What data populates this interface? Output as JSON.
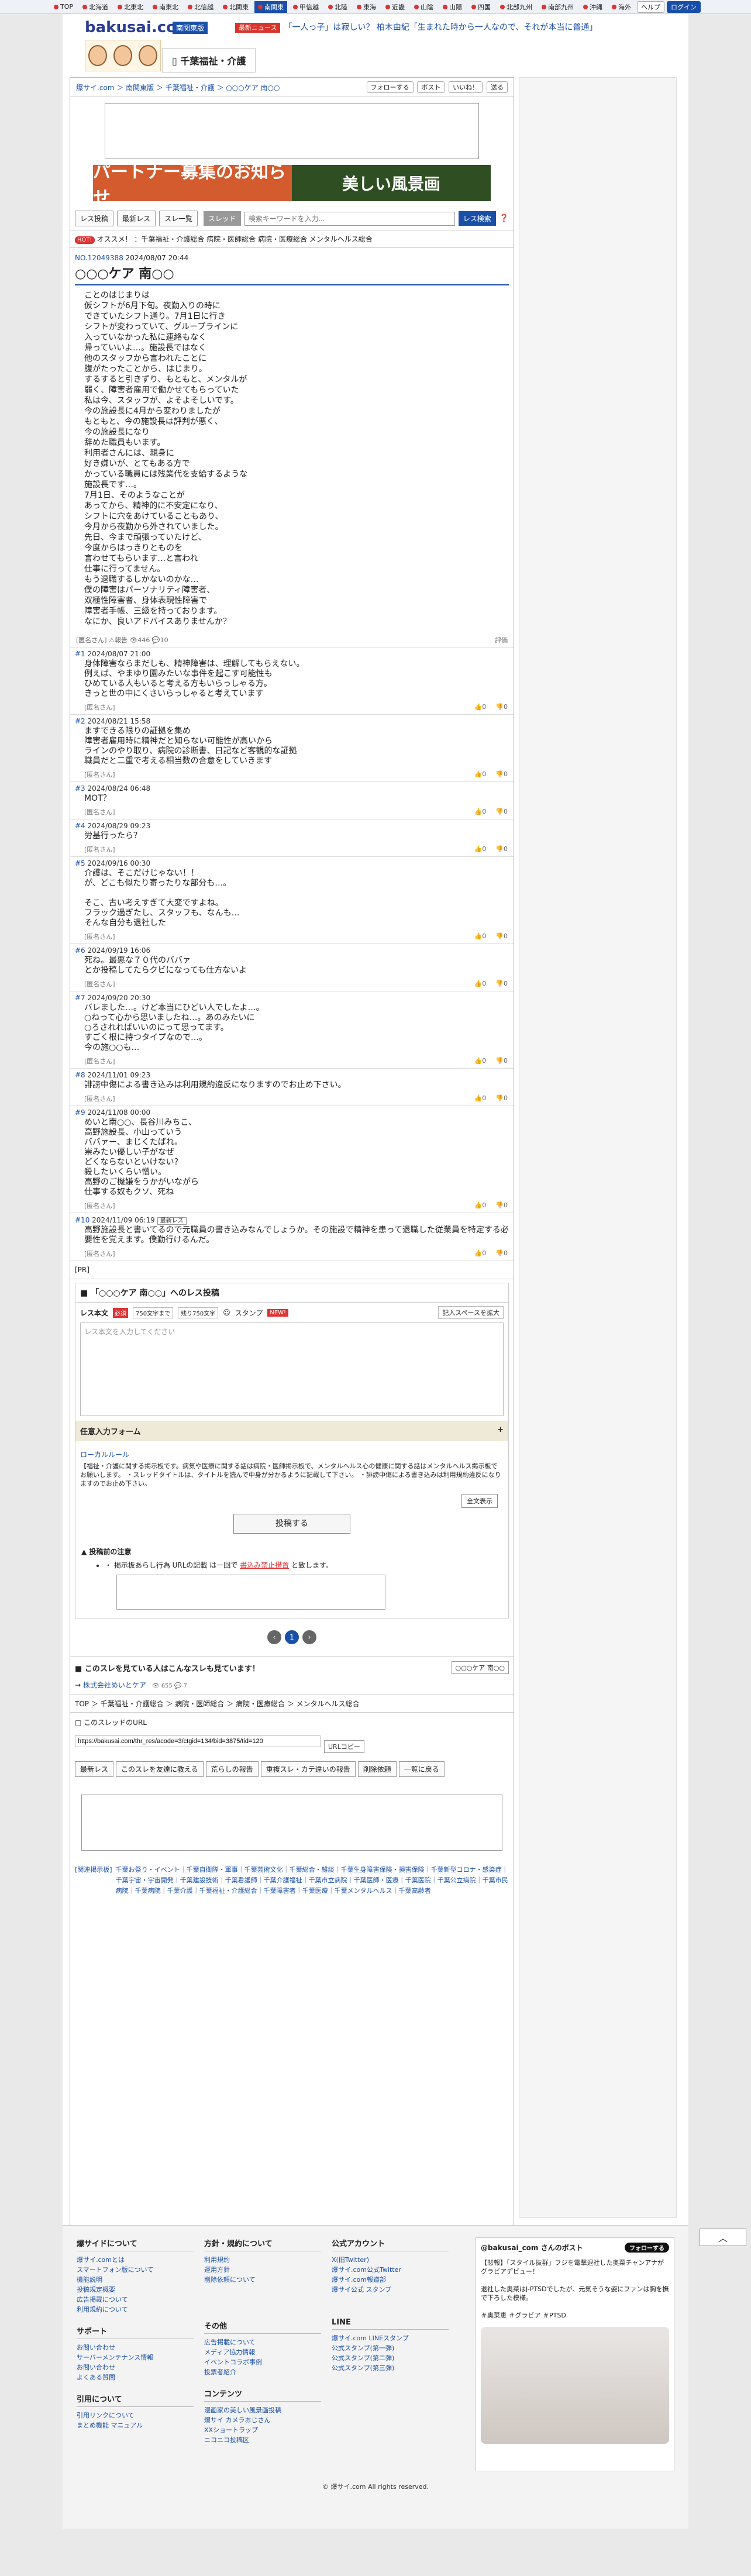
{
  "regionbar": {
    "items": [
      {
        "label": "TOP"
      },
      {
        "label": "北海道"
      },
      {
        "label": "北東北"
      },
      {
        "label": "南東北"
      },
      {
        "label": "北信越"
      },
      {
        "label": "北関東"
      },
      {
        "label": "南関東",
        "active": true
      },
      {
        "label": "甲信越"
      },
      {
        "label": "北陸"
      },
      {
        "label": "東海"
      },
      {
        "label": "近畿"
      },
      {
        "label": "山陰"
      },
      {
        "label": "山陽"
      },
      {
        "label": "四国"
      },
      {
        "label": "北部九州"
      },
      {
        "label": "南部九州"
      },
      {
        "label": "沖縄"
      },
      {
        "label": "海外"
      }
    ],
    "help": "ヘルプ",
    "login": "ログイン"
  },
  "header": {
    "logo": "bakusai.com",
    "logo_suffix": "",
    "region": "南関東版",
    "news_tag": "最新ニュース",
    "news": "「一人っ子」は寂しい？ 柏木由紀「生まれた時から一人なので、それが本当に普通」",
    "category": "千葉福祉・介護"
  },
  "breadcrumb": {
    "text": "爆サイ.com ＞ 南関東版 ＞ 千葉福祉・介護 ＞ ○○○ケア 南○○",
    "follow": "フォローする",
    "post": "ポスト",
    "like": "いいね！",
    "send": "送る"
  },
  "banner": {
    "left": "パートナー募集のお知らせ",
    "right": "美しい風景画"
  },
  "toolbar": {
    "b1": "レス投稿",
    "b2": "最新レス",
    "b3": "スレ一覧",
    "select": "スレッド",
    "placeholder": "検索キーワードを入力...",
    "search": "レス検索"
  },
  "tags": {
    "hot": "HOT!",
    "text": "オススメ！ ：千葉福祉・介護総合 病院・医師総合 病院・医療総合 メンタルヘルス総合"
  },
  "thread": {
    "number": "NO.12049388",
    "date": "2024/08/07 20:44",
    "title": "○○○ケア 南○○",
    "body": "ことのはじまりは\n仮シフトが6月下旬。夜勤入りの時に\nできていたシフト通り。7月1日に行き\nシフトが変わっていて、グループラインに\n入っていなかった私に連絡もなく\n帰っていいよ…。施設長ではなく\n他のスタッフから言われたことに\n腹がたったことから、はじまり。\nするすると引きずり、もともと、メンタルが\n弱く、障害者雇用で働かせてもらっていた\n私は今、スタッフが、よそよそしいです。\n今の施設長に4月から変わりましたが\nもともと、今の施設長は評判が悪く、\n今の施設長になり\n辞めた職員もいます。\n利用者さんには、親身に\n好き嫌いが、とてもある方で\nかっている職員には残業代を支給するような\n施設長です…。\n7月1日、そのようなことが\nあってから、精神的に不安定になり、\nシフトに穴をあけていることもあり、\n今月から夜勤から外されていました。\n先日、今まで頑張っていたけど、\n今度からはっきりとものを\n言わせてもらいます…と言われ\n仕事に行ってません。\nもう退職するしかないのかな…\n僕の障害はパーソナリティ障害者、\n双極性障害者、身体表現性障害で\n障害者手帳、三級を持っております。\nなにか、良いアドバイスありませんか？",
    "author": "[匿名さん]",
    "report": "報告",
    "views": "446",
    "comments": "10",
    "label_eval": "評価"
  },
  "responses": [
    {
      "no": "#1",
      "date": "2024/08/07 21:00",
      "body": "身体障害ならまだしも、精神障害は、理解してもらえない。\n例えば、やまゆり園みたいな事件を起こす可能性も\nひめている人もいると考える方もいらっしゃる方。\nきっと世の中にくさいらっしゃると考えています",
      "author": "[匿名さん]",
      "up": "0",
      "down": "0"
    },
    {
      "no": "#2",
      "date": "2024/08/21 15:58",
      "body": "ますできる限りの証拠を集め\n障害者雇用時に精神だと知らない可能性が高いから\nラインのやり取り、病院の診断書、日記など客観的な証拠\n職員だと二重で考える相当数の合意をしていきます",
      "author": "[匿名さん]",
      "up": "0",
      "down": "0"
    },
    {
      "no": "#3",
      "date": "2024/08/24 06:48",
      "body": "MOT？",
      "author": "[匿名さん]",
      "up": "0",
      "down": "0"
    },
    {
      "no": "#4",
      "date": "2024/08/29 09:23",
      "body": "労基行ったら？",
      "author": "[匿名さん]",
      "up": "0",
      "down": "0"
    },
    {
      "no": "#5",
      "date": "2024/09/16 00:30",
      "body": "介護は、そこだけじゃない！！\nが、どこも似たり寄ったりな部分も…。\n\nそこ、古い考えすぎて大変ですよね。\nフラック過ぎたし、スタッフも、なんも…\nそんな自分も退社した",
      "author": "[匿名さん]",
      "up": "0",
      "down": "0"
    },
    {
      "no": "#6",
      "date": "2024/09/19 16:06",
      "body": "死ね。最悪な７０代のババァ\nとか投稿してたらクビになっても仕方ないよ",
      "author": "[匿名さん]",
      "up": "0",
      "down": "0"
    },
    {
      "no": "#7",
      "date": "2024/09/20 20:30",
      "body": "バレました…。けど本当にひどい人でしたよ…。\n○ねって心から思いましたね…。あのみたいに\n○ろされればいいのにって思ってます。\nすごく根に持つタイプなので…。\n今の施○○も…",
      "author": "[匿名さん]",
      "up": "0",
      "down": "0"
    },
    {
      "no": "#8",
      "date": "2024/11/01 09:23",
      "body": "誹謗中傷による書き込みは利用規約違反になりますのでお止め下さい。",
      "author": "[匿名さん]",
      "up": "0",
      "down": "0"
    },
    {
      "no": "#9",
      "date": "2024/11/08 00:00",
      "body": "めいと南○○、長谷川みちこ、\n高野施設長、小山っていう\nババァー、まじくたばれ。\n崇みたい優しい子がなぜ\nどくならないといけない？\n殺したいくらい憎い。\n高野のご機嫌をうかがいながら\n仕事する奴もクソ、死ね\n",
      "author": "[匿名さん]",
      "up": "0",
      "down": "0"
    },
    {
      "no": "#10",
      "date": "2024/11/09 06:19",
      "newest": "最新レス",
      "body": "高野施設長と書いてるので元職員の書き込みなんでしょうか。その施設で精神を患って退職した従業員を特定する必要性を覚えます。僕勤行けるんだ。",
      "author": "[匿名さん]",
      "up": "0",
      "down": "0"
    }
  ],
  "pr": "[PR]",
  "form": {
    "title": "「○○○ケア 南○○」へのレス投稿",
    "name": "レス本文",
    "req": "必須",
    "chip1": "750文字まで",
    "chip2": "残り750文字",
    "stamp": "スタンプ",
    "new": "NEW!",
    "space": "記入スペースを拡大",
    "placeholder": "レス本文を入力してください",
    "optional": "任意入力フォーム",
    "plus": "+",
    "rules_title": "ローカルルール",
    "rules_text": "【福祉・介護に関する掲示板です。病気や医療に関する話は病院・医師掲示板で、メンタルヘルス心の健康に関する話はメンタルヘルス掲示板でお願いします。\n・スレッドタイトルは、タイトルを読んで中身が分かるように記載して下さい。\n・誹謗中傷による書き込みは利用規約違反になりますのでお止め下さい。",
    "expand": "全文表示",
    "submit": "投稿する",
    "caution_title": "投稿前の注意",
    "caution_text": "・ 掲示板あらし行為 URLの記載 は一回で",
    "caution_link": "書込み禁止措置",
    "caution_end": "と致します。"
  },
  "pager": {
    "current": "1"
  },
  "related": {
    "title": "このスレを見ている人はこんなスレも見ています！",
    "btn": "○○○ケア 南○○",
    "item": "株式会社めいとケア",
    "views": "655",
    "comments": "7"
  },
  "bottom": {
    "crumb": "TOP ＞ 千葉福祉・介護総合 ＞ 病院・医師総合 ＞ 病院・医療総合 ＞ メンタルヘルス総合",
    "url_label": "このスレッドのURL",
    "url": "https://bakusai.com/thr_res/acode=3/ctgid=134/bid=3875/tid=120",
    "copy": "URLコピー",
    "b1": "最新レス",
    "b2": "このスレを友達に教える",
    "b3": "荒らしの報告",
    "b4": "重複スレ・カテ違いの報告",
    "b5": "削除依頼",
    "b6": "一覧に戻る"
  },
  "tagcloud": {
    "label": "[関連掲示板]",
    "list": "千葉お祭り・イベント｜千葉自衛隊・軍事｜千葉芸術文化｜千葉総合・雑談｜千葉生身障害保険・損害保険｜千葉新型コロナ・感染症｜千葉宇宙・宇宙開発｜千葉建設技術｜千葉看護師｜千葉介護福祉｜千葉市立病院｜千葉医師・医療｜千葉医院｜千葉公立病院｜千葉市民病院｜千葉病院｜千葉介護｜千葉福祉・介護総合｜千葉障害者｜千葉医療｜千葉メンタルヘルス｜千葉高齢者"
  },
  "scroll": "︿",
  "footer": {
    "c1": {
      "title": "爆サイドについて",
      "items": [
        "爆サイ.comとは",
        "スマートフォン版について",
        "機能説明",
        "投稿規定概要",
        "広告掲載について",
        "利用規約について"
      ]
    },
    "c2": {
      "title": "方針・規約について",
      "items": [
        "利用規約",
        "運用方針",
        "削除依頼について"
      ]
    },
    "c3": {
      "title": "公式アカウント",
      "items": [
        "X(旧Twitter)",
        "爆サイ.com公式Twitter",
        "爆サイ.com報道部",
        "爆サイ公式 スタンプ"
      ]
    },
    "c4": {
      "title": "サポート",
      "items": [
        "お問い合わせ",
        "サーバーメンテナンス情報",
        "お問い合わせ",
        "よくある質問"
      ]
    },
    "c5": {
      "title": "その他",
      "items": [
        "広告掲載について",
        "メディア協力情報",
        "イベントコラボ事例",
        "投票者紹介"
      ]
    },
    "c6": {
      "title": "LINE",
      "items": [
        "爆サイ.com LINEスタンプ",
        "公式スタンプ(第一弾)",
        "公式スタンプ(第二弾)",
        "公式スタンプ(第三弾)"
      ]
    },
    "c7": {
      "title": "引用について",
      "items": [
        "引用リンクについて",
        "まとめ機能 マニュアル"
      ]
    },
    "c8": {
      "title": "コンテンツ",
      "items": [
        "漫画家の美しい風景画投稿",
        "爆サイ カメラおじさん",
        "XXショートラップ",
        "ニコニコ投稿区"
      ]
    },
    "twitter_title": "@bakusai_com さんのポスト",
    "follow": "フォローする",
    "tweet": "【悲報】「スタイル抜群」フジを電撃退社した奥菜チャンアナがグラビアデビュー！\n\n退社した奥菜はJ-PTSDでしたが、元気そうな姿にファンは胸を撫で下ろした模様。\n\n＃奥菜恵 ＃グラビア ＃PTSD",
    "copyright": "© 爆サイ.com All rights reserved."
  }
}
